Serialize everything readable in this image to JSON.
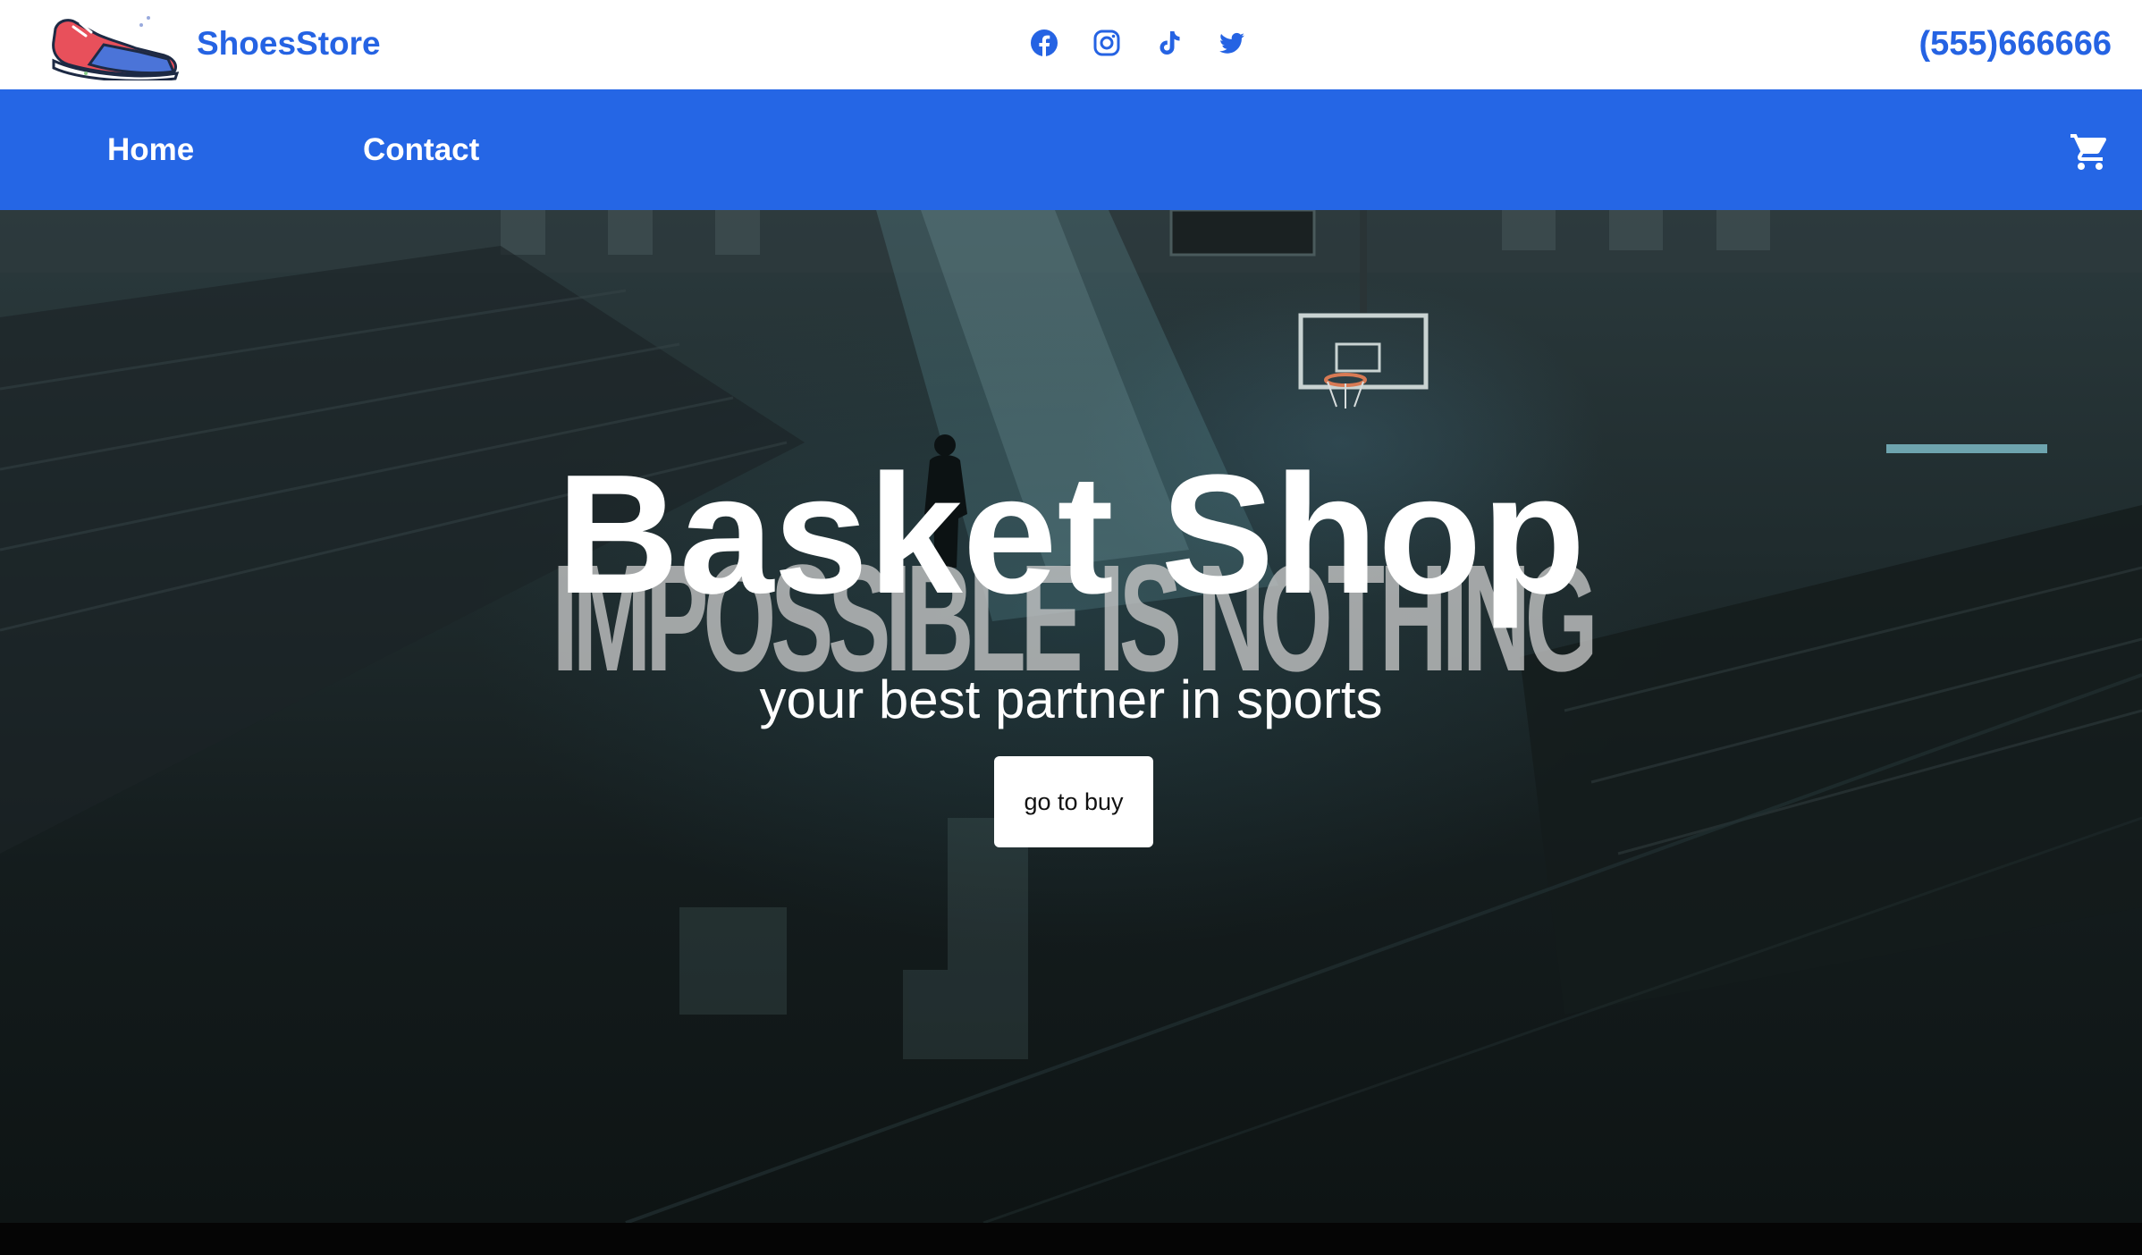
{
  "header": {
    "brand": "ShoesStore",
    "logo_icon": "sneaker-icon",
    "phone": "(555)666666",
    "socials": [
      {
        "name": "facebook-icon",
        "color": "#2563e3"
      },
      {
        "name": "instagram-icon",
        "color": "#2563e3"
      },
      {
        "name": "tiktok-icon",
        "color": "#2563e3"
      },
      {
        "name": "twitter-icon",
        "color": "#2563e3"
      }
    ]
  },
  "nav": {
    "links": [
      "Home",
      "Contact"
    ],
    "cart_icon": "shopping-cart-icon"
  },
  "hero": {
    "title": "Basket Shop",
    "background_text": "IMPOSSIBLE IS NOTHING",
    "subtitle": "your best partner in sports",
    "cta_label": "go to buy"
  },
  "colors": {
    "brand": "#2563e3",
    "nav_bg": "#2566e5",
    "text_on_dark": "#ffffff",
    "button_bg": "#ffffff"
  }
}
